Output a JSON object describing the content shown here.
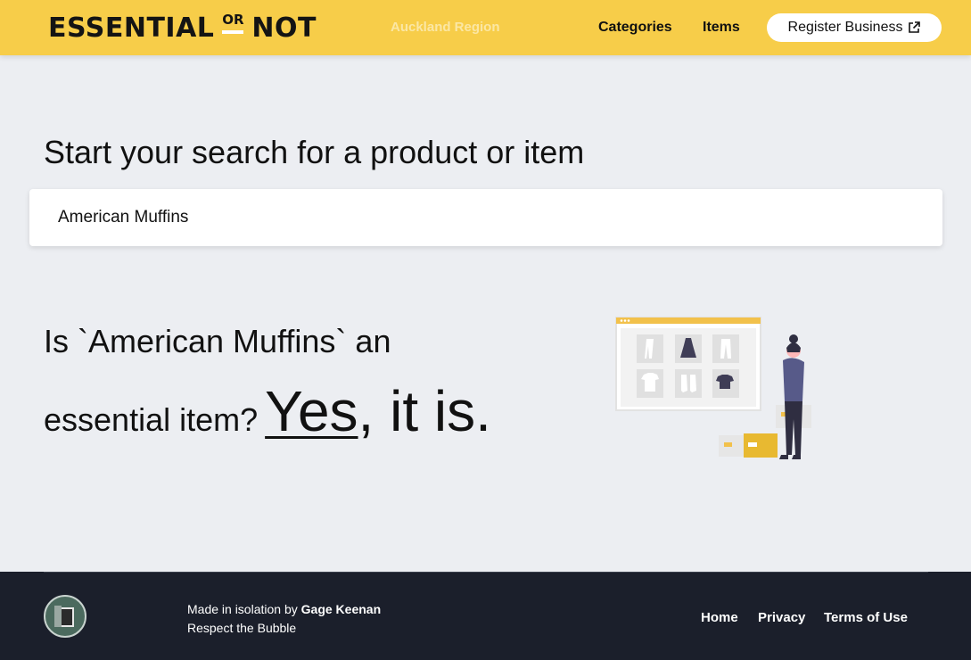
{
  "header": {
    "logo": {
      "left": "ESSENTIAL",
      "mid": "OR",
      "right": "NOT"
    },
    "region": "Auckland Region",
    "nav": {
      "categories": "Categories",
      "items": "Items"
    },
    "register_label": "Register Business",
    "colors": {
      "bar": "#f7cd49",
      "region_text": "#fbe7a4"
    }
  },
  "search": {
    "heading": "Start your search for a product or item",
    "value": "American Muffins"
  },
  "result": {
    "question_line1": "Is `American Muffins` an",
    "question_line2": "essential item?",
    "answer": "Yes",
    "answer_tail": ", it is."
  },
  "footer": {
    "credit_prefix": "Made in isolation by ",
    "credit_name": "Gage Keenan",
    "tagline": "Respect the Bubble",
    "links": {
      "home": "Home",
      "privacy": "Privacy",
      "terms": "Terms of Use"
    },
    "colors": {
      "bg": "#1b1f2b"
    }
  }
}
